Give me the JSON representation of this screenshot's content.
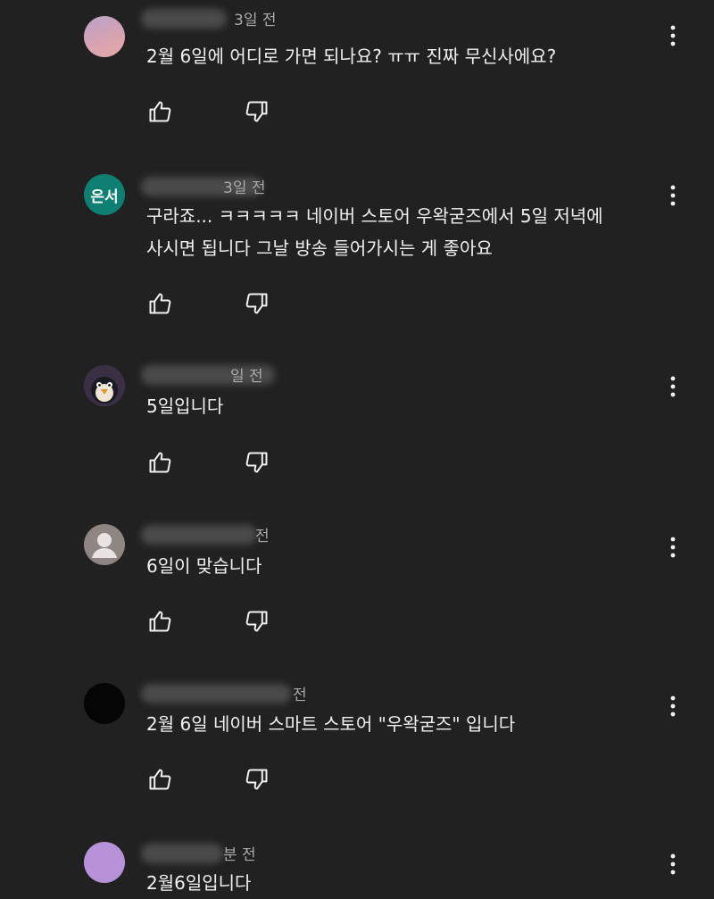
{
  "comments": [
    {
      "avatar": "gradient-avatar",
      "avatar_text": "",
      "time": "3일 전",
      "text": "2월 6일에 어디로 가면 되나요? ㅠㅠ 진짜 무신사에요?"
    },
    {
      "avatar": "initials-avatar",
      "avatar_text": "은서",
      "time": "3일 전",
      "text": "구라죠... ㅋㅋㅋㅋㅋ 네이버 스토어 우왁굳즈에서 5일 저녁에 사시면 됩니다 그날 방송 들어가시는 게 좋아요"
    },
    {
      "avatar": "penguin-avatar",
      "avatar_text": "",
      "time": "일 전",
      "text": "5일입니다"
    },
    {
      "avatar": "default-person-avatar",
      "avatar_text": "",
      "time": "전",
      "text": "6일이 맞습니다"
    },
    {
      "avatar": "black-avatar",
      "avatar_text": "",
      "time": "전",
      "text": "2월 6일 네이버 스마트 스토어 \"우왁굳즈\" 입니다"
    },
    {
      "avatar": "lilac-avatar",
      "avatar_text": "",
      "time": "분 전",
      "text": "2월6일입니다"
    }
  ],
  "icons": {
    "like": "thumbs-up-icon",
    "dislike": "thumbs-down-icon",
    "more": "more-vertical-icon"
  },
  "colors": {
    "background": "#212121",
    "text": "#f1f1f1",
    "meta": "#aaaaaa",
    "teal_avatar": "#0f7f73",
    "lilac_avatar": "#b892d8"
  }
}
